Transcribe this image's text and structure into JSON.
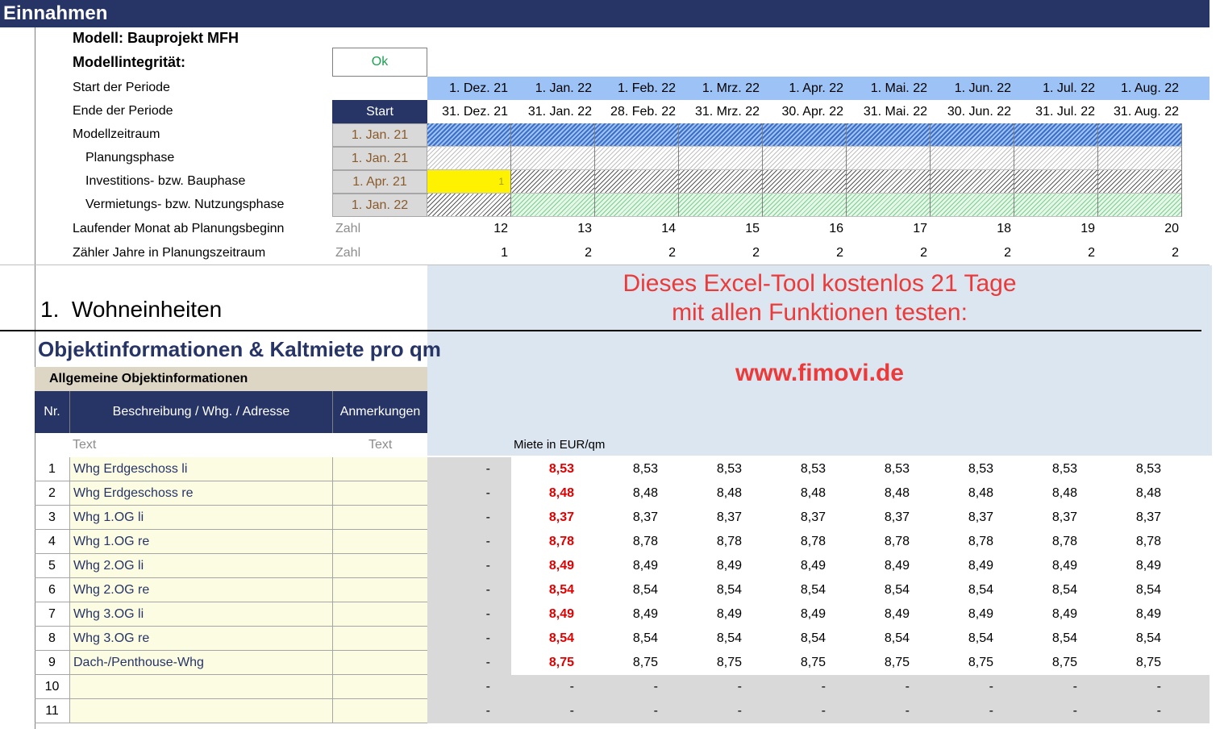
{
  "sheet_title": "Einnahmen",
  "model": {
    "name_label": "Modell: Bauprojekt MFH",
    "integrity_label": "Modellintegrität:",
    "integrity_value": "Ok"
  },
  "timeline": {
    "row_labels": {
      "start": "Start der Periode",
      "end": "Ende der Periode",
      "model_period": "Modellzeitraum",
      "planning": "Planungsphase",
      "construction": "Investitions- bzw. Bauphase",
      "rental": "Vermietungs- bzw. Nutzungsphase",
      "month_counter": "Laufender Monat ab Planungsbeginn",
      "year_counter": "Zähler Jahre in Planungszeitraum"
    },
    "start_header": "Start",
    "phase_start": {
      "model_period": "1. Jan. 21",
      "planning": "1. Jan. 21",
      "construction": "1. Apr. 21",
      "rental": "1. Jan. 22"
    },
    "unit_zahl": "Zahl",
    "period_starts": [
      "1. Dez. 21",
      "1. Jan. 22",
      "1. Feb. 22",
      "1. Mrz. 22",
      "1. Apr. 22",
      "1. Mai. 22",
      "1. Jun. 22",
      "1. Jul. 22",
      "1. Aug. 22"
    ],
    "period_ends": [
      "31. Dez. 21",
      "31. Jan. 22",
      "28. Feb. 22",
      "31. Mrz. 22",
      "30. Apr. 22",
      "31. Mai. 22",
      "30. Jun. 22",
      "31. Jul. 22",
      "31. Aug. 22"
    ],
    "months": [
      "12",
      "13",
      "14",
      "15",
      "16",
      "17",
      "18",
      "19",
      "20"
    ],
    "years": [
      "1",
      "2",
      "2",
      "2",
      "2",
      "2",
      "2",
      "2",
      "2"
    ],
    "flag_one": "1"
  },
  "section": {
    "number": "1.",
    "title": "Wohneinheiten",
    "obj_title": "Objektinformationen & Kaltmiete pro qm",
    "general_info": "Allgemeine Objektinformationen"
  },
  "promo": {
    "line1": "Dieses Excel-Tool kostenlos 21 Tage",
    "line2": "mit allen Funktionen testen:",
    "url": "www.fimovi.de"
  },
  "table": {
    "headers": {
      "nr": "Nr.",
      "desc": "Beschreibung / Whg. / Adresse",
      "notes": "Anmerkungen"
    },
    "units": {
      "desc": "Text",
      "notes": "Text",
      "rent": "Miete in EUR/qm"
    },
    "dash": "-",
    "rows": [
      {
        "nr": "1",
        "desc": "Whg Erdgeschoss li",
        "rent": "8,53"
      },
      {
        "nr": "2",
        "desc": "Whg Erdgeschoss re",
        "rent": "8,48"
      },
      {
        "nr": "3",
        "desc": "Whg 1.OG li",
        "rent": "8,37"
      },
      {
        "nr": "4",
        "desc": "Whg 1.OG re",
        "rent": "8,78"
      },
      {
        "nr": "5",
        "desc": "Whg 2.OG li",
        "rent": "8,49"
      },
      {
        "nr": "6",
        "desc": "Whg 2.OG re",
        "rent": "8,54"
      },
      {
        "nr": "7",
        "desc": "Whg 3.OG li",
        "rent": "8,49"
      },
      {
        "nr": "8",
        "desc": "Whg 3.OG re",
        "rent": "8,54"
      },
      {
        "nr": "9",
        "desc": "Dach-/Penthouse-Whg",
        "rent": "8,75"
      },
      {
        "nr": "10",
        "desc": "",
        "rent": ""
      },
      {
        "nr": "11",
        "desc": "",
        "rent": ""
      }
    ]
  },
  "colors": {
    "navy": "#263466",
    "date_band": "#9dc3f6",
    "promo_bg": "#dce6f1",
    "promo_text": "#ea3a3a",
    "ok_green": "#1aa050",
    "rent_red": "#e00000",
    "input_yellow": "#fcfce3"
  }
}
